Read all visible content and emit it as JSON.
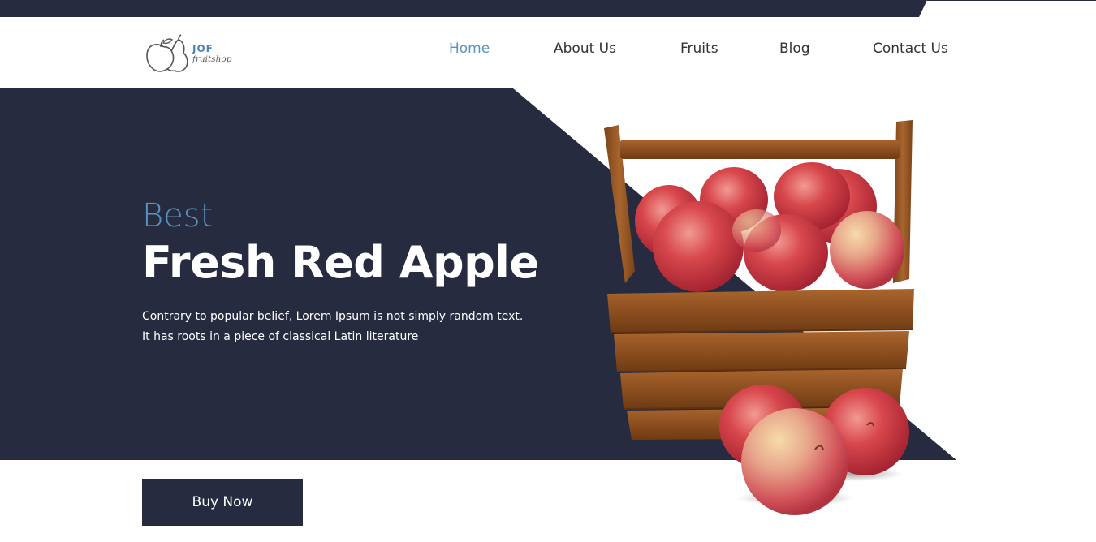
{
  "colors": {
    "dark_navy": "#262b3f",
    "accent_blue": "#5a93bf",
    "white": "#ffffff",
    "text_dark": "#333333"
  },
  "header": {
    "logo": {
      "icon": "apple-pear-outline-icon",
      "brand": "JOF",
      "tagline": "fruitshop"
    },
    "nav": [
      {
        "label": "Home",
        "active": true
      },
      {
        "label": "About Us",
        "active": false
      },
      {
        "label": "Fruits",
        "active": false
      },
      {
        "label": "Blog",
        "active": false
      },
      {
        "label": "Contact Us",
        "active": false
      }
    ]
  },
  "hero": {
    "subtitle": "Best",
    "title": "Fresh Red Apple",
    "description": "Contrary to popular belief, Lorem Ipsum is not simply random text. It has roots in a piece of classical Latin literature",
    "button_label": "Buy Now",
    "image": "wooden-basket-of-red-apples"
  }
}
